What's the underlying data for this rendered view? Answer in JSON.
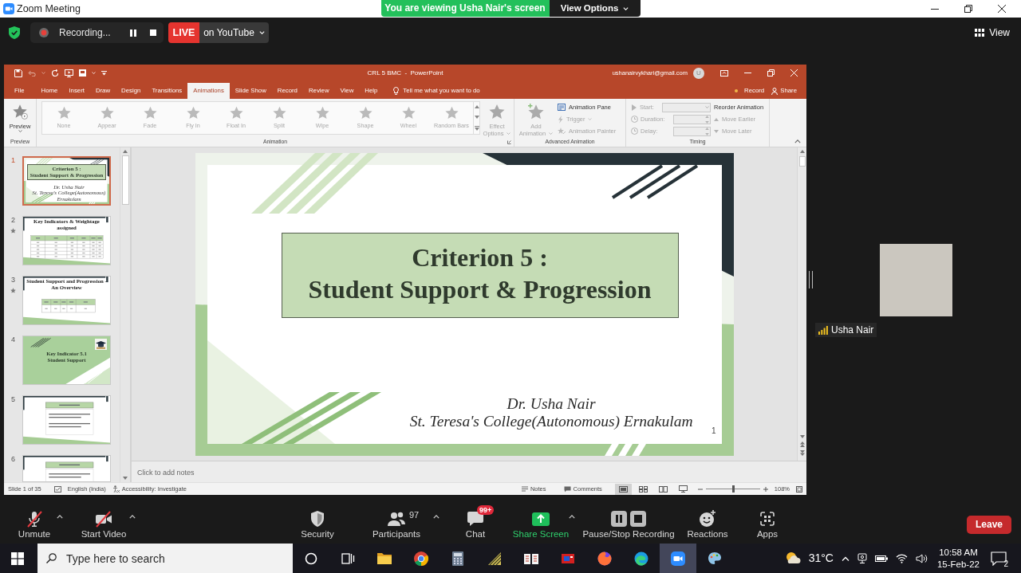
{
  "window": {
    "title": "Zoom Meeting"
  },
  "banner": {
    "message": "You are viewing Usha Nair's screen",
    "view_options": "View Options"
  },
  "meeting_bar": {
    "recording": {
      "label": "Recording..."
    },
    "live": {
      "badge": "LIVE",
      "destination": "on YouTube"
    },
    "view_button": "View"
  },
  "powerpoint": {
    "title": "CRL 5 BMC  -  PowerPoint",
    "account": {
      "email": "ushanairvykhari@gmail.com",
      "initial": "U"
    },
    "tabs": [
      {
        "label": "File",
        "selected": false
      },
      {
        "label": "Home",
        "selected": false
      },
      {
        "label": "Insert",
        "selected": false
      },
      {
        "label": "Draw",
        "selected": false
      },
      {
        "label": "Design",
        "selected": false
      },
      {
        "label": "Transitions",
        "selected": false
      },
      {
        "label": "Animations",
        "selected": true
      },
      {
        "label": "Slide Show",
        "selected": false
      },
      {
        "label": "Record",
        "selected": false
      },
      {
        "label": "Review",
        "selected": false
      },
      {
        "label": "View",
        "selected": false
      },
      {
        "label": "Help",
        "selected": false
      }
    ],
    "tell_me": "Tell me what you want to do",
    "record": "Record",
    "share": "Share",
    "ribbon": {
      "preview": {
        "label": "Preview",
        "group": "Preview",
        "disabled": false
      },
      "animations": [
        {
          "label": "None",
          "disabled": true
        },
        {
          "label": "Appear",
          "disabled": true
        },
        {
          "label": "Fade",
          "disabled": true
        },
        {
          "label": "Fly In",
          "disabled": true
        },
        {
          "label": "Float In",
          "disabled": true
        },
        {
          "label": "Split",
          "disabled": true
        },
        {
          "label": "Wipe",
          "disabled": true
        },
        {
          "label": "Shape",
          "disabled": true
        },
        {
          "label": "Wheel",
          "disabled": true
        },
        {
          "label": "Random Bars",
          "disabled": true
        }
      ],
      "effect_options": {
        "lines": [
          "Effect",
          "Options"
        ],
        "disabled": true
      },
      "animation_group": "Animation",
      "add_animation": {
        "lines": [
          "Add",
          "Animation"
        ],
        "disabled": true
      },
      "advanced_items": [
        {
          "kind": "pane",
          "label": "Animation Pane",
          "disabled": false
        },
        {
          "kind": "trigger",
          "label": "Trigger",
          "disabled": true
        },
        {
          "kind": "painter",
          "label": "Animation Painter",
          "disabled": true
        }
      ],
      "advanced_group": "Advanced Animation",
      "timing_fields": [
        {
          "kind": "dropdown",
          "label": "Start:",
          "disabled": true
        },
        {
          "kind": "spin",
          "label": "Duration:",
          "disabled": true
        },
        {
          "kind": "spin",
          "label": "Delay:",
          "disabled": true
        }
      ],
      "reorder_title": "Reorder Animation",
      "reorder_items": [
        {
          "kind": "earlier",
          "label": "Move Earlier",
          "disabled": true
        },
        {
          "kind": "later",
          "label": "Move Later",
          "disabled": true
        }
      ],
      "timing_group": "Timing"
    },
    "thumbnails": [
      {
        "number": "1",
        "selected": true,
        "animated": false,
        "kind": "title",
        "title_lines": [
          "Criterion 5 :",
          "Student Support & Progression"
        ],
        "byline": [
          "Dr. Usha Nair",
          "St. Teresa's College(Autonomous) Ernakulam"
        ]
      },
      {
        "number": "2",
        "selected": false,
        "animated": true,
        "kind": "table",
        "title_lines": [
          "Key Indicators & Weightage assigned"
        ]
      },
      {
        "number": "3",
        "selected": false,
        "animated": true,
        "kind": "summary",
        "title_lines": [
          "Student Support and Progression - An Overview"
        ]
      },
      {
        "number": "4",
        "selected": false,
        "animated": false,
        "kind": "section",
        "title_lines": [
          "Key Indicator 5.1",
          "Student Support"
        ]
      },
      {
        "number": "5",
        "selected": false,
        "animated": false,
        "kind": "text"
      },
      {
        "number": "6",
        "selected": false,
        "animated": false,
        "kind": "text"
      }
    ],
    "slide": {
      "title_lines": [
        "Criterion 5 :",
        "Student Support & Progression"
      ],
      "author": "Dr. Usha Nair",
      "institution": "St. Teresa's College(Autonomous) Ernakulam",
      "page": "1"
    },
    "notes": {
      "placeholder": "Click to add notes"
    },
    "status_bar": {
      "slide": "Slide 1 of 35",
      "language": "English (India)",
      "accessibility": "Accessibility: Investigate",
      "notes": "Notes",
      "comments": "Comments",
      "views": [
        {
          "kind": "normal",
          "selected": true
        },
        {
          "kind": "sorter",
          "selected": false
        },
        {
          "kind": "reading",
          "selected": false
        },
        {
          "kind": "slideshow",
          "selected": false
        }
      ],
      "zoom": {
        "level": 0.51,
        "reading": "108%"
      }
    }
  },
  "participant": {
    "name": "Usha Nair"
  },
  "toolbar": {
    "items": [
      {
        "kind": "mic",
        "label": "Unmute",
        "off": true,
        "caret": true
      },
      {
        "kind": "video",
        "label": "Start Video",
        "off": true,
        "caret": true
      },
      {
        "kind": "security",
        "label": "Security",
        "caret": false
      },
      {
        "kind": "participants",
        "label": "Participants",
        "count": "97",
        "caret": true
      },
      {
        "kind": "chat",
        "label": "Chat",
        "badge": "99+",
        "caret": false
      },
      {
        "kind": "share",
        "label": "Share Screen",
        "caret": true
      },
      {
        "kind": "recording",
        "label": "Pause/Stop Recording",
        "caret": false
      },
      {
        "kind": "reactions",
        "label": "Reactions",
        "caret": false
      },
      {
        "kind": "apps",
        "label": "Apps",
        "caret": false
      }
    ],
    "leave": "Leave"
  },
  "taskbar": {
    "search": {
      "placeholder": "Type here to search"
    },
    "apps": [
      {
        "kind": "cortana",
        "active": false
      },
      {
        "kind": "taskview",
        "active": false
      },
      {
        "kind": "explorer",
        "active": false
      },
      {
        "kind": "chrome",
        "active": false
      },
      {
        "kind": "calculator",
        "active": false
      },
      {
        "kind": "stripes",
        "active": false
      },
      {
        "kind": "reader",
        "active": false
      },
      {
        "kind": "redapp",
        "active": false
      },
      {
        "kind": "firefox",
        "active": false
      },
      {
        "kind": "edge",
        "active": false
      },
      {
        "kind": "zoom",
        "active": true
      },
      {
        "kind": "paint",
        "active": false
      }
    ],
    "weather": "31°C",
    "time": "10:58 AM",
    "date": "15-Feb-22",
    "notifications": "2"
  }
}
